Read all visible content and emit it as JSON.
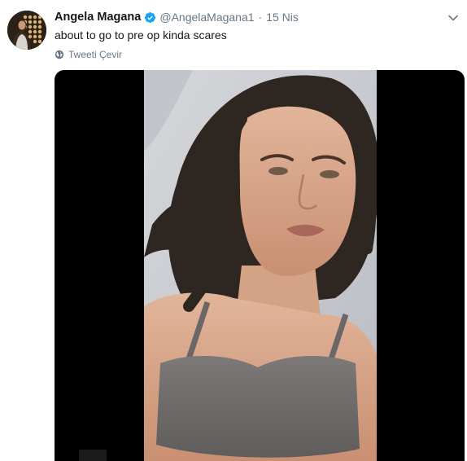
{
  "tweet": {
    "display_name": "Angela Magana",
    "handle": "@AngelaMagana1",
    "separator": "·",
    "date": "15 Nis",
    "text": "about to go to pre op kinda scares",
    "translate_label": "Tweeti Çevir",
    "verified": true
  },
  "icons": {
    "verified": "verified-badge-icon",
    "menu": "chevron-down-icon",
    "translate": "globe-icon"
  },
  "colors": {
    "primary_text": "#14171a",
    "secondary_text": "#657786",
    "verified_blue": "#1da1f2",
    "media_background": "#000000"
  }
}
